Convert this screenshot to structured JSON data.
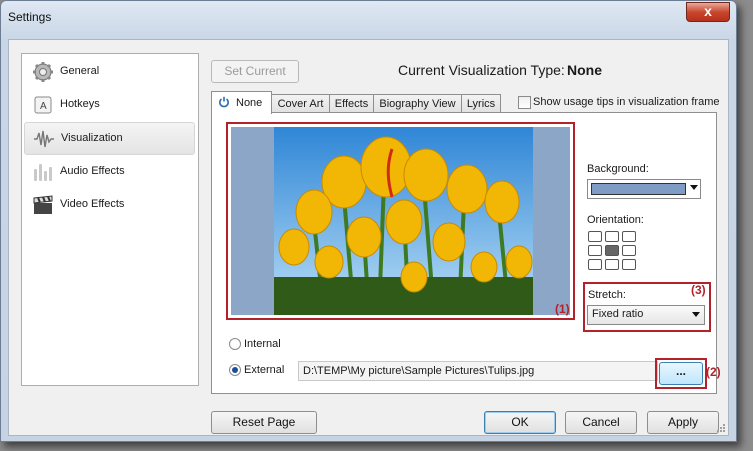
{
  "window": {
    "title": "Settings",
    "close_glyph": "x"
  },
  "sidebar": {
    "items": [
      {
        "label": "General",
        "icon": "gear-icon",
        "selected": false
      },
      {
        "label": "Hotkeys",
        "icon": "key-icon",
        "selected": false
      },
      {
        "label": "Visualization",
        "icon": "waveform-icon",
        "selected": true
      },
      {
        "label": "Audio Effects",
        "icon": "equalizer-icon",
        "selected": false
      },
      {
        "label": "Video Effects",
        "icon": "clapperboard-icon",
        "selected": false
      }
    ]
  },
  "header": {
    "set_current_label": "Set Current",
    "viz_type_label": "Current Visualization Type:",
    "viz_type_value": "None"
  },
  "tabs": [
    {
      "label": "None",
      "active": true,
      "icon": "power-icon"
    },
    {
      "label": "Cover Art",
      "active": false
    },
    {
      "label": "Effects",
      "active": false
    },
    {
      "label": "Biography View",
      "active": false
    },
    {
      "label": "Lyrics",
      "active": false
    }
  ],
  "show_tips": {
    "label": "Show usage tips in visualization frame",
    "checked": false
  },
  "preview": {
    "annotation": "(1)",
    "image_icon": "tulips-photo"
  },
  "background": {
    "label": "Background:",
    "color": "#7f9dc4"
  },
  "orientation": {
    "label": "Orientation:",
    "selected": "center"
  },
  "stretch": {
    "label": "Stretch:",
    "value": "Fixed ratio",
    "annotation": "(3)"
  },
  "source": {
    "internal_label": "Internal",
    "external_label": "External",
    "selected": "External",
    "path": "D:\\TEMP\\My picture\\Sample Pictures\\Tulips.jpg",
    "browse_label": "...",
    "annotation": "(2)"
  },
  "footer": {
    "reset_label": "Reset Page",
    "ok_label": "OK",
    "cancel_label": "Cancel",
    "apply_label": "Apply"
  },
  "colors": {
    "accent_red": "#b3222a",
    "selection_blue": "#3c7fb1"
  }
}
